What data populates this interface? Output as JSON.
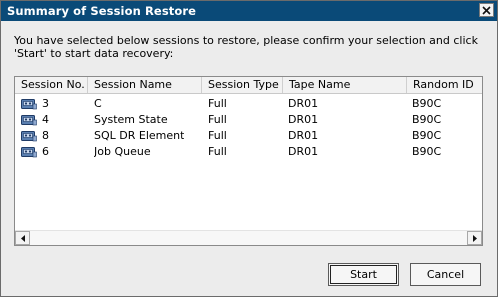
{
  "dialog": {
    "title": "Summary of Session Restore",
    "instruction": "You have selected below sessions to restore, please confirm your selection and click 'Start' to start data recovery:"
  },
  "table": {
    "columns": [
      "Session No.",
      "Session Name",
      "Session Type",
      "Tape Name",
      "Random ID"
    ],
    "rows": [
      {
        "session_no": "3",
        "session_name": "C",
        "session_type": "Full",
        "tape_name": "DR01",
        "random_id": "B90C"
      },
      {
        "session_no": "4",
        "session_name": "System State",
        "session_type": "Full",
        "tape_name": "DR01",
        "random_id": "B90C"
      },
      {
        "session_no": "8",
        "session_name": "SQL DR Element",
        "session_type": "Full",
        "tape_name": "DR01",
        "random_id": "B90C"
      },
      {
        "session_no": "6",
        "session_name": "Job Queue",
        "session_type": "Full",
        "tape_name": "DR01",
        "random_id": "B90C"
      }
    ]
  },
  "buttons": {
    "start": "Start",
    "cancel": "Cancel"
  },
  "icons": {
    "close": "close-icon",
    "row": "tape-session-icon",
    "scroll_left": "scroll-left-arrow-icon",
    "scroll_right": "scroll-right-arrow-icon"
  },
  "colors": {
    "titlebar": "#0a4a78",
    "title_text": "#ffffff",
    "dialog_bg": "#ececec",
    "list_bg": "#ffffff"
  }
}
